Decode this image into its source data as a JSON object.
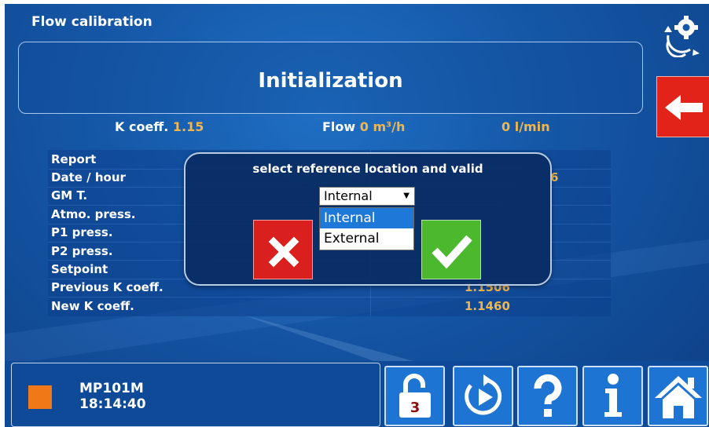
{
  "header": {
    "title": "Flow calibration",
    "state": "Initialization"
  },
  "stats": {
    "k_label": "K coeff.",
    "k_value": "1.15",
    "flow_label": "Flow",
    "flow_value": "0 m³/h",
    "flow_lmin": "0 l/min"
  },
  "report": {
    "labels": [
      "Report",
      "Date / hour",
      "GM T.",
      "Atmo. press.",
      "P1 press.",
      "P2 press.",
      "Setpoint",
      "Previous K coeff.",
      "New K coeff."
    ],
    "visible_values": {
      "date_partial": "6",
      "previous_k_partial": "1.1506",
      "new_k": "1.1460"
    }
  },
  "dialog": {
    "message": "select reference location and valid",
    "selected": "Internal",
    "options": [
      "Internal",
      "External"
    ],
    "cancel_icon": "close-icon",
    "confirm_icon": "check-icon"
  },
  "status": {
    "machine": "MP101M",
    "time": "18:14:40",
    "indicator_color": "#f07817"
  },
  "toolbar": {
    "lock_level": "3",
    "icons": [
      "unlock-icon",
      "replay-icon",
      "help-icon",
      "info-icon",
      "home-icon"
    ]
  },
  "colors": {
    "accent_value": "#f2b64a",
    "back": "#e2231a",
    "cancel": "#d9201e",
    "confirm": "#4cb82e"
  }
}
